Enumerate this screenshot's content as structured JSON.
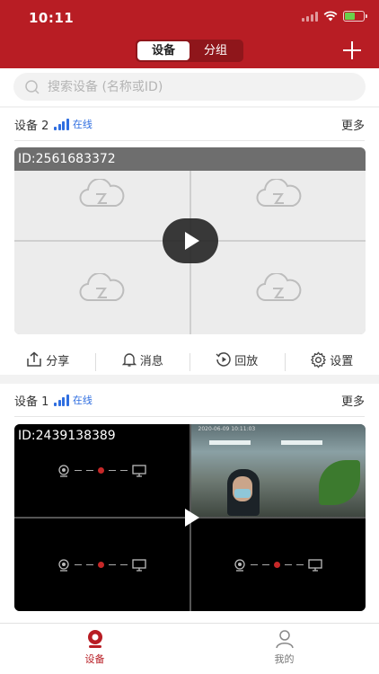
{
  "status_bar": {
    "time": "10:11"
  },
  "header": {
    "tabs": [
      "设备",
      "分组"
    ],
    "active_tab": "设备"
  },
  "search": {
    "placeholder": "搜索设备 (名称或ID)"
  },
  "devices": [
    {
      "name": "设备 2",
      "status": "在线",
      "more": "更多",
      "id_label": "ID:2561683372"
    },
    {
      "name": "设备 1",
      "status": "在线",
      "more": "更多",
      "id_label": "ID:2439138389",
      "cam_timestamp": "2020-06-09 10:11:03"
    }
  ],
  "actions": [
    "分享",
    "消息",
    "回放",
    "设置"
  ],
  "tabbar": {
    "items": [
      "设备",
      "我的"
    ],
    "active": "设备"
  },
  "colors": {
    "brand": "#b81d24",
    "online": "#2f6ee0"
  }
}
